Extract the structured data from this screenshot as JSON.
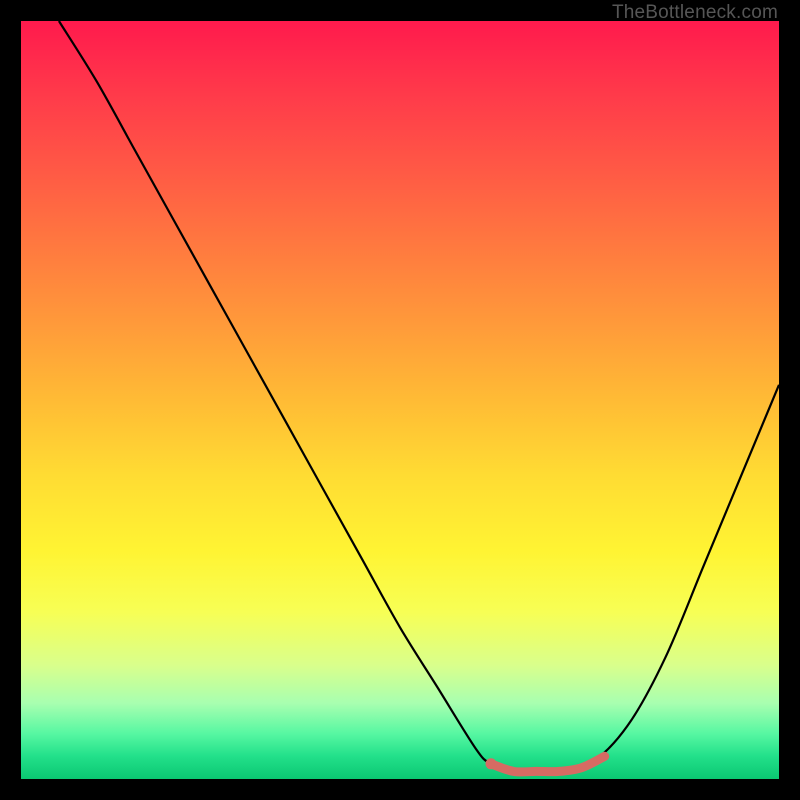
{
  "watermark": "TheBottleneck.com",
  "chart_data": {
    "type": "line",
    "title": "",
    "xlabel": "",
    "ylabel": "",
    "xlim": [
      0,
      100
    ],
    "ylim": [
      0,
      100
    ],
    "series": [
      {
        "name": "bottleneck-curve",
        "x": [
          5,
          10,
          15,
          20,
          25,
          30,
          35,
          40,
          45,
          50,
          55,
          60,
          62,
          65,
          70,
          75,
          80,
          85,
          90,
          95,
          100
        ],
        "y": [
          100,
          92,
          83,
          74,
          65,
          56,
          47,
          38,
          29,
          20,
          12,
          4,
          2,
          1,
          1,
          2,
          7,
          16,
          28,
          40,
          52
        ]
      },
      {
        "name": "optimal-range-marker",
        "x": [
          62,
          65,
          68,
          71,
          74,
          77
        ],
        "y": [
          2,
          1,
          1,
          1,
          1.5,
          3
        ]
      }
    ],
    "colors": {
      "curve": "#000000",
      "marker": "#d66b63"
    }
  }
}
